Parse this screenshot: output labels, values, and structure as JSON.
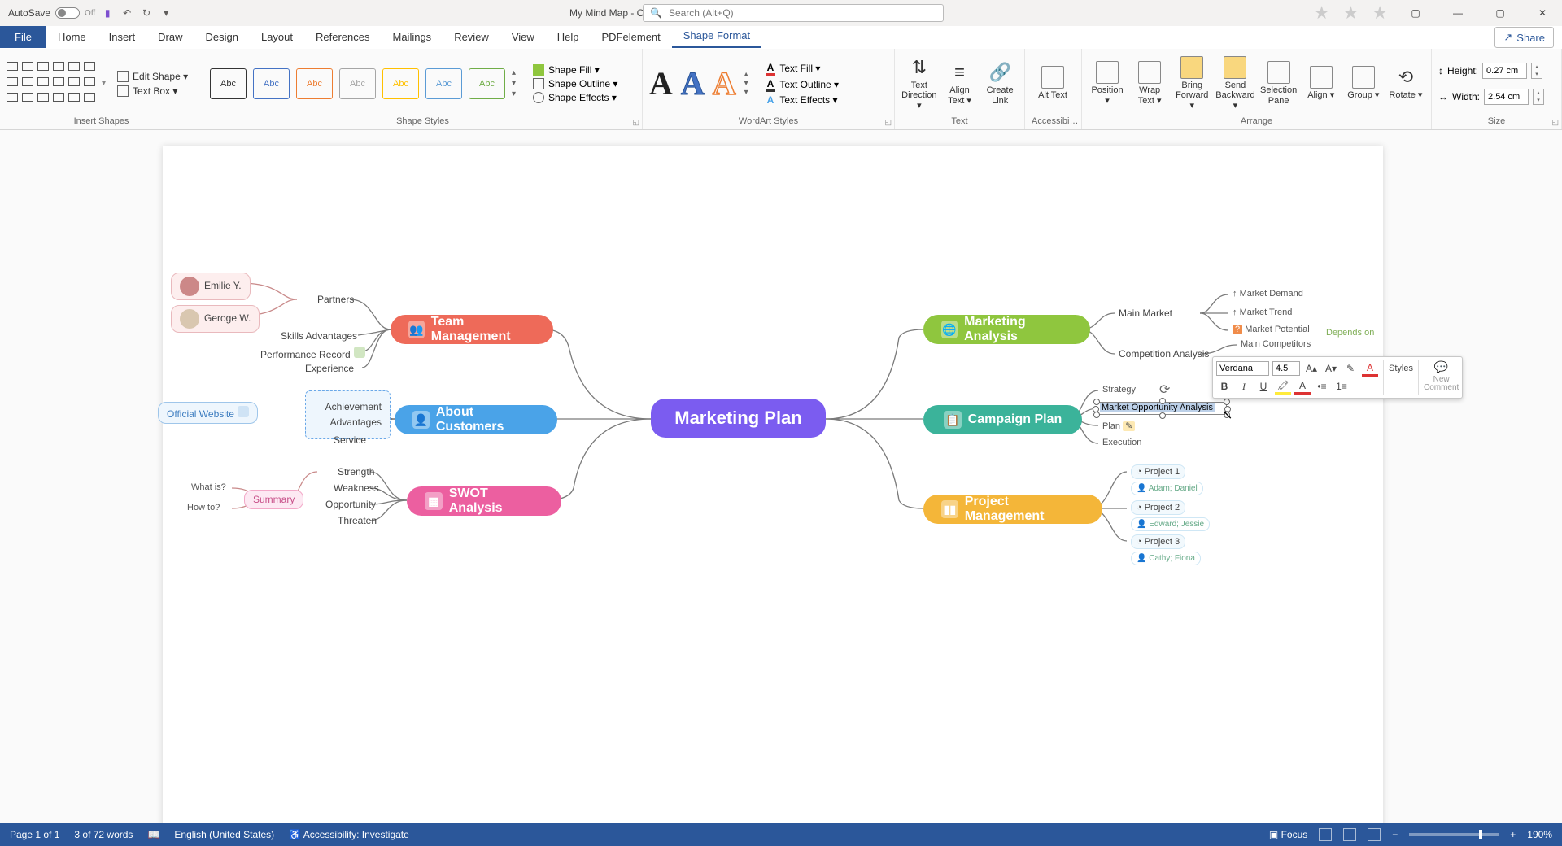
{
  "titlebar": {
    "autosave_label": "AutoSave",
    "autosave_state": "Off",
    "doc_title": "My Mind Map  -  Compatibility Mode  -  Saved to this PC ▾",
    "search_placeholder": "Search (Alt+Q)"
  },
  "tabs": {
    "file": "File",
    "items": [
      "Home",
      "Insert",
      "Draw",
      "Design",
      "Layout",
      "References",
      "Mailings",
      "Review",
      "View",
      "Help",
      "PDFelement"
    ],
    "active": "Shape Format",
    "share": "Share"
  },
  "ribbon": {
    "insert_shapes": {
      "label": "Insert Shapes",
      "edit_shape": "Edit Shape ▾",
      "text_box": "Text Box  ▾"
    },
    "shape_styles": {
      "label": "Shape Styles",
      "swatch_text": "Abc",
      "fill": "Shape Fill ▾",
      "outline": "Shape Outline ▾",
      "effects": "Shape Effects ▾"
    },
    "wordart": {
      "label": "WordArt Styles",
      "text_fill": "Text Fill ▾",
      "text_outline": "Text Outline ▾",
      "text_effects": "Text Effects ▾"
    },
    "text": {
      "label": "Text",
      "direction": "Text Direction ▾",
      "align_text": "Align Text ▾",
      "create_link": "Create Link"
    },
    "accessibility": {
      "label": "Accessibi…",
      "alt_text": "Alt Text"
    },
    "arrange": {
      "label": "Arrange",
      "position": "Position ▾",
      "wrap": "Wrap Text ▾",
      "forward": "Bring Forward ▾",
      "backward": "Send Backward ▾",
      "selection": "Selection Pane",
      "align": "Align ▾",
      "group": "Group ▾",
      "rotate": "Rotate ▾"
    },
    "size": {
      "label": "Size",
      "height_label": "Height:",
      "height": "0.27 cm",
      "width_label": "Width:",
      "width": "2.54 cm"
    }
  },
  "mindmap": {
    "center": "Marketing Plan",
    "left": {
      "team": {
        "label": "Team Management",
        "partners_label": "Partners",
        "emilie": "Emilie Y.",
        "george": "Geroge W.",
        "skills": "Skills Advantages",
        "perf": "Performance Record",
        "exp": "Experience"
      },
      "cust": {
        "label": "About Customers",
        "achievement": "Achievement",
        "advantages": "Advantages",
        "service": "Service",
        "website": "Official Website"
      },
      "swot": {
        "label": "SWOT Analysis",
        "summary": "Summary",
        "what": "What is?",
        "how": "How to?",
        "strength": "Strength",
        "weakness": "Weakness",
        "opportunity": "Opportunity",
        "threaten": "Threaten"
      }
    },
    "right": {
      "mkt": {
        "label": "Marketing Analysis",
        "main_market": "Main Market",
        "market_demand": "Market Demand",
        "market_trend": "Market Trend",
        "market_potential": "Market Potential",
        "competition": "Competition Analysis",
        "main_competitors": "Main Competitors",
        "depends_on": "Depends on"
      },
      "camp": {
        "label": "Campaign Plan",
        "strategy": "Strategy",
        "moa": "Market Opportunity Analysis",
        "plan": "Plan",
        "execution": "Execution"
      },
      "proj": {
        "label": "Project Management",
        "p1": "Project 1",
        "p1_people": "Adam; Daniel",
        "p2": "Project 2",
        "p2_people": "Edward; Jessie",
        "p3": "Project 3",
        "p3_people": "Cathy; Fiona"
      }
    }
  },
  "minibar": {
    "font": "Verdana",
    "size": "4.5",
    "styles": "Styles",
    "new_comment": "New Comment"
  },
  "statusbar": {
    "page": "Page 1 of 1",
    "words": "3 of 72 words",
    "lang": "English (United States)",
    "acc": "Accessibility: Investigate",
    "focus": "Focus",
    "zoom": "190%"
  }
}
